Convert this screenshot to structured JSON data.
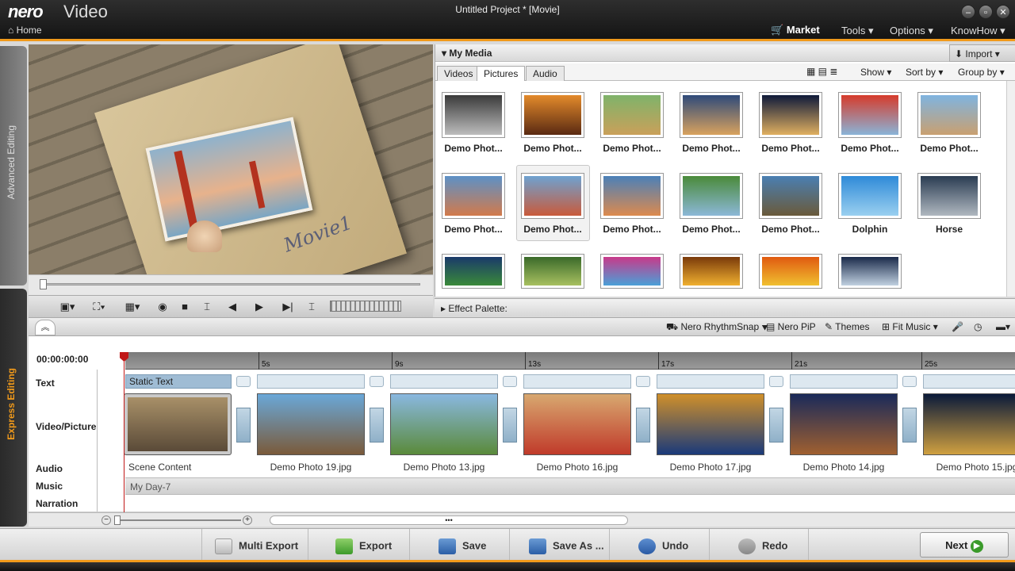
{
  "app": {
    "logo": "nero",
    "product": "Video",
    "window_title": "Untitled Project * [Movie]",
    "home": "Home"
  },
  "menu": {
    "market": "Market",
    "tools": "Tools ▾",
    "options": "Options ▾",
    "knowhow": "KnowHow ▾"
  },
  "side": {
    "advanced": "Advanced Editing",
    "express": "Express Editing"
  },
  "preview": {
    "caption": "Movie1"
  },
  "media": {
    "title": "My Media",
    "import": "Import ▾",
    "tabs": [
      "Videos",
      "Pictures",
      "Audio"
    ],
    "show": "Show ▾",
    "sort": "Sort by ▾",
    "group": "Group by ▾",
    "row1": [
      "Demo Phot...",
      "Demo Phot...",
      "Demo Phot...",
      "Demo Phot...",
      "Demo Phot...",
      "Demo Phot...",
      "Demo Phot..."
    ],
    "row2": [
      "Demo Phot...",
      "Demo Phot...",
      "Demo Phot...",
      "Demo Phot...",
      "Demo Phot...",
      "Dolphin",
      "Horse"
    ]
  },
  "effect": {
    "label": "Effect Palette:"
  },
  "timeline_tools": {
    "rhythm": "Nero RhythmSnap ▾",
    "pip": "Nero PiP",
    "themes": "Themes",
    "fitmusic": "Fit Music ▾"
  },
  "timeline": {
    "timecode": "00:00:00:00",
    "ticks": [
      "5s",
      "9s",
      "13s",
      "17s",
      "21s",
      "25s"
    ],
    "tracks": {
      "text": "Text",
      "video": "Video/Picture",
      "audio": "Audio",
      "music": "Music",
      "narration": "Narration"
    },
    "static_text": "Static Text",
    "clips": [
      "Scene Content",
      "Demo Photo 19.jpg",
      "Demo Photo 13.jpg",
      "Demo Photo 16.jpg",
      "Demo Photo 17.jpg",
      "Demo Photo 14.jpg",
      "Demo Photo 15.jpg"
    ],
    "music_clip": "My Day-7"
  },
  "footer": {
    "multi_export": "Multi Export",
    "export": "Export",
    "save": "Save",
    "save_as": "Save As ...",
    "undo": "Undo",
    "redo": "Redo",
    "next": "Next"
  }
}
